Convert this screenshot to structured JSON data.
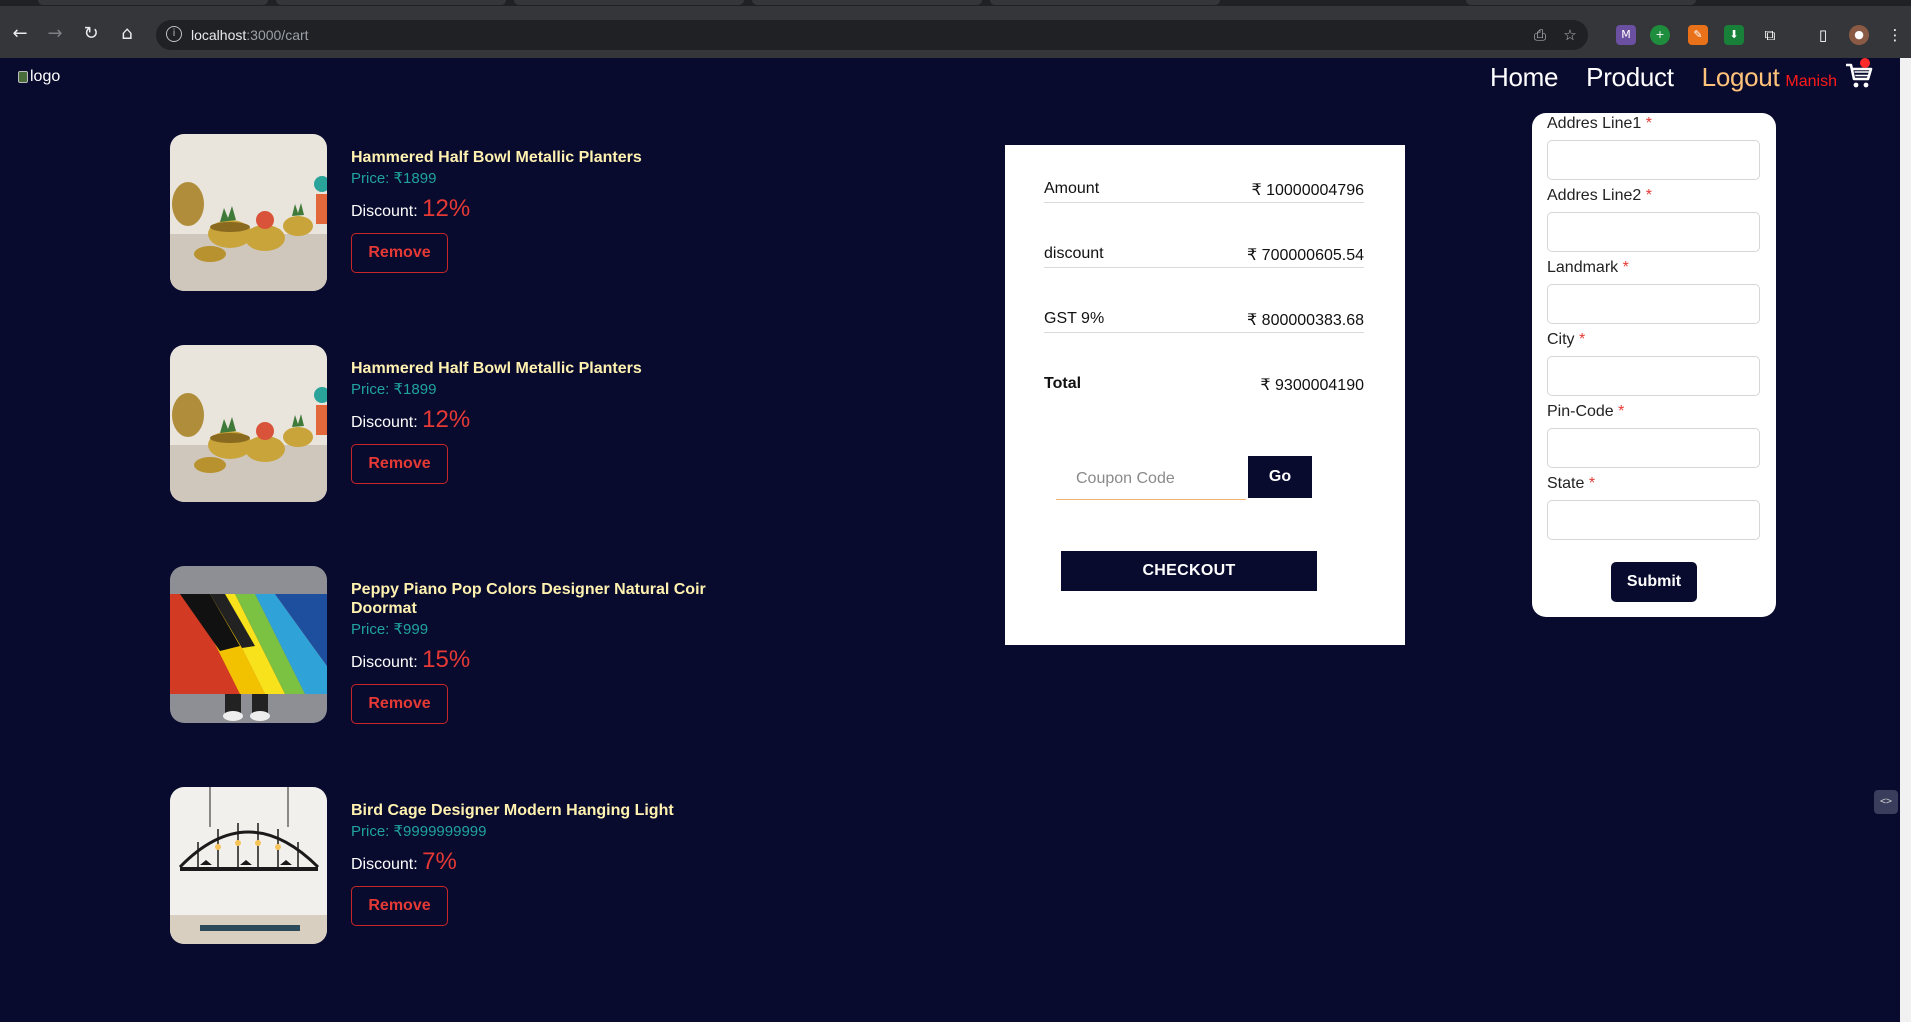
{
  "browser": {
    "url_host": "localhost",
    "url_path": ":3000/cart"
  },
  "header": {
    "logo_alt": "logo",
    "nav": {
      "home": "Home",
      "product": "Product",
      "logout": "Logout",
      "user": "Manish"
    }
  },
  "cart": {
    "price_label": "Price: ",
    "discount_label": "Discount: ",
    "remove_label": "Remove",
    "items": [
      {
        "name": "Hammered Half Bowl Metallic Planters",
        "price": "₹1899",
        "discount": "12%",
        "image": "planters"
      },
      {
        "name": "Hammered Half Bowl Metallic Planters",
        "price": "₹1899",
        "discount": "12%",
        "image": "planters"
      },
      {
        "name": "Peppy Piano Pop Colors Designer Natural Coir Doormat",
        "price": "₹999",
        "discount": "15%",
        "image": "doormat"
      },
      {
        "name": "Bird Cage Designer Modern Hanging Light",
        "price": "₹9999999999",
        "discount": "7%",
        "image": "lamp"
      }
    ]
  },
  "summary": {
    "rows": [
      {
        "label": "Amount",
        "value": "₹ 10000004796"
      },
      {
        "label": "discount",
        "value": "₹ 700000605.54"
      },
      {
        "label": "GST 9%",
        "value": "₹ 800000383.68"
      },
      {
        "label": "Total",
        "value": "₹ 9300004190"
      }
    ],
    "coupon_placeholder": "Coupon Code",
    "go_label": "Go",
    "checkout_label": "CHECKOUT"
  },
  "address_form": {
    "fields": [
      {
        "label": "Addres Line1",
        "required": "*"
      },
      {
        "label": "Addres Line2",
        "required": "*"
      },
      {
        "label": "Landmark",
        "required": "*"
      },
      {
        "label": "City",
        "required": "*"
      },
      {
        "label": "Pin-Code",
        "required": "*"
      },
      {
        "label": "State",
        "required": "*"
      }
    ],
    "submit_label": "Submit"
  },
  "colors": {
    "background": "#080a2e",
    "item_name": "#fff2b0",
    "price": "#20a39e",
    "discount_pct": "#e53935",
    "logout": "#ffc27a",
    "user": "#ff1a1a"
  }
}
